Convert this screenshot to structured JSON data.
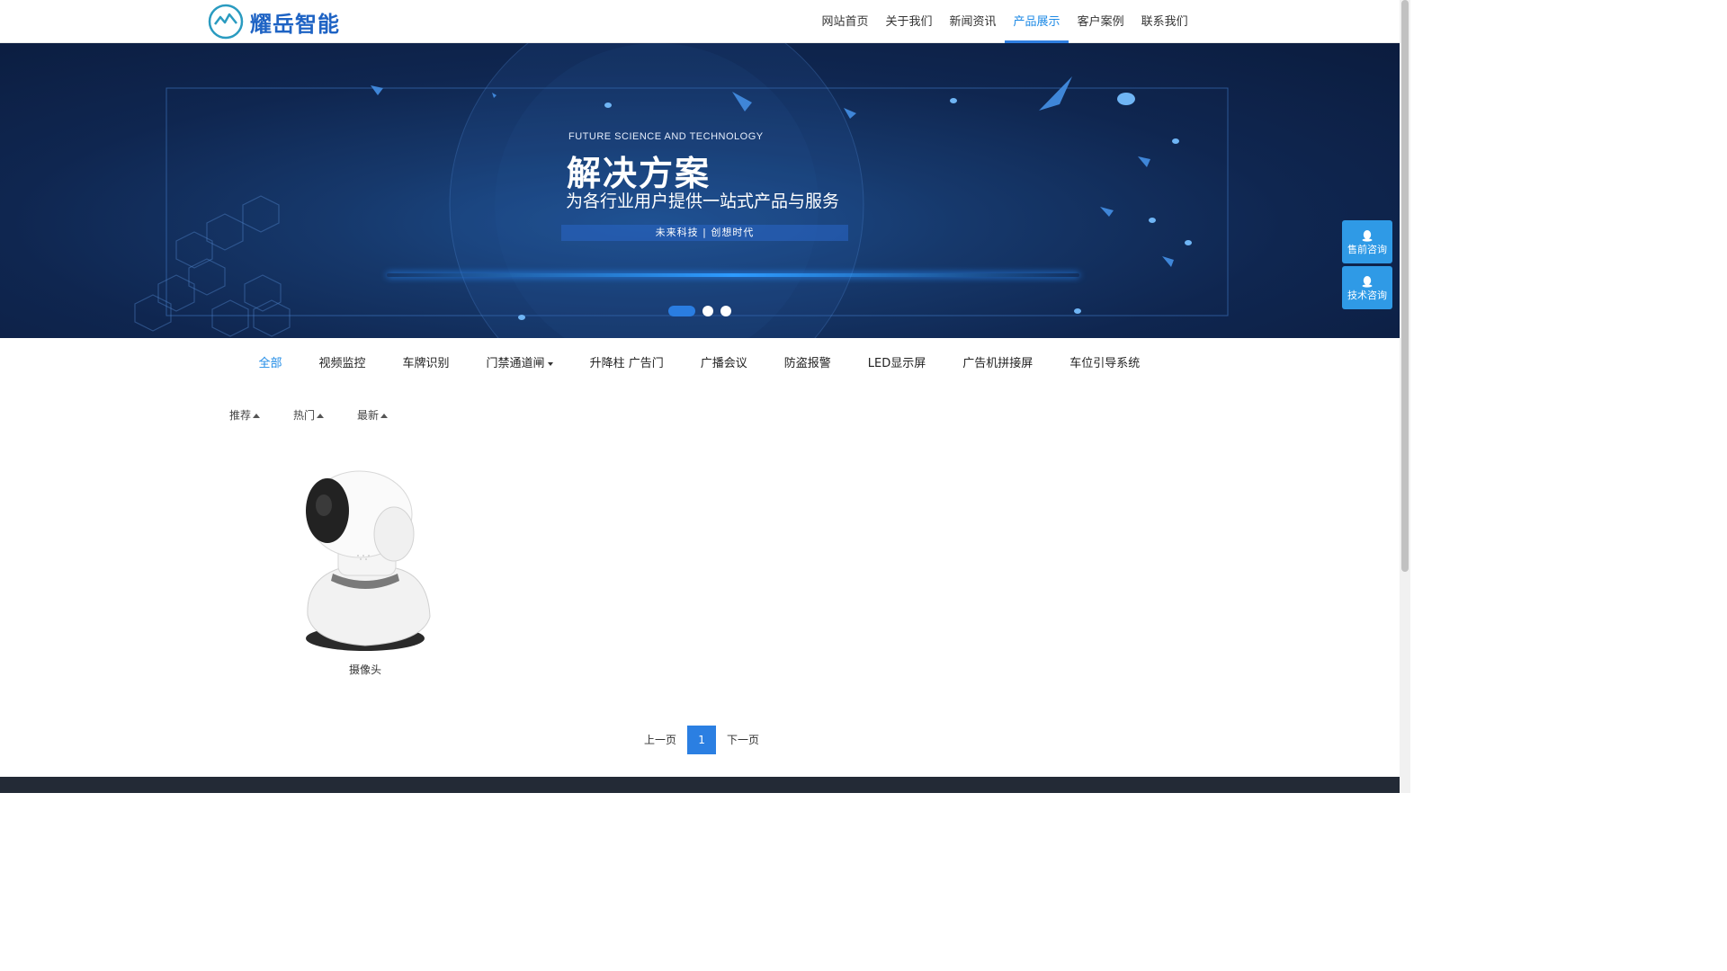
{
  "header": {
    "logo_text": "耀岳智能",
    "logo_icon": "mountain-circle-logo",
    "nav": [
      {
        "label": "网站首页",
        "active": false
      },
      {
        "label": "关于我们",
        "active": false
      },
      {
        "label": "新闻资讯",
        "active": false
      },
      {
        "label": "产品展示",
        "active": true
      },
      {
        "label": "客户案例",
        "active": false
      },
      {
        "label": "联系我们",
        "active": false
      }
    ]
  },
  "banner": {
    "eyebrow": "FUTURE SCIENCE AND TECHNOLOGY",
    "title": "解决方案",
    "subtitle": "为各行业用户提供一站式产品与服务",
    "tagline": "未来科技 | 创想时代",
    "slides": 3,
    "active_slide": 1
  },
  "float_buttons": [
    {
      "label": "售前咨询",
      "icon": "qq-icon"
    },
    {
      "label": "技术咨询",
      "icon": "qq-icon"
    }
  ],
  "categories": [
    {
      "label": "全部",
      "active": true
    },
    {
      "label": "视频监控"
    },
    {
      "label": "车牌识别"
    },
    {
      "label": "门禁通道闸",
      "dropdown": true
    },
    {
      "label": "升降柱 广告门"
    },
    {
      "label": "广播会议"
    },
    {
      "label": "防盗报警"
    },
    {
      "label": "LED显示屏"
    },
    {
      "label": "广告机拼接屏"
    },
    {
      "label": "车位引导系统"
    }
  ],
  "sort": [
    {
      "label": "推荐"
    },
    {
      "label": "热门"
    },
    {
      "label": "最新"
    }
  ],
  "products": [
    {
      "name": "摄像头",
      "image": "camera-image"
    }
  ],
  "pagination": {
    "prev": "上一页",
    "current": "1",
    "next": "下一页"
  },
  "colors": {
    "accent": "#1e8ae6",
    "brand": "#1e63c4",
    "float_button": "#2f9ae6",
    "pager_active": "#2b7fe2",
    "footer": "#232a36"
  }
}
